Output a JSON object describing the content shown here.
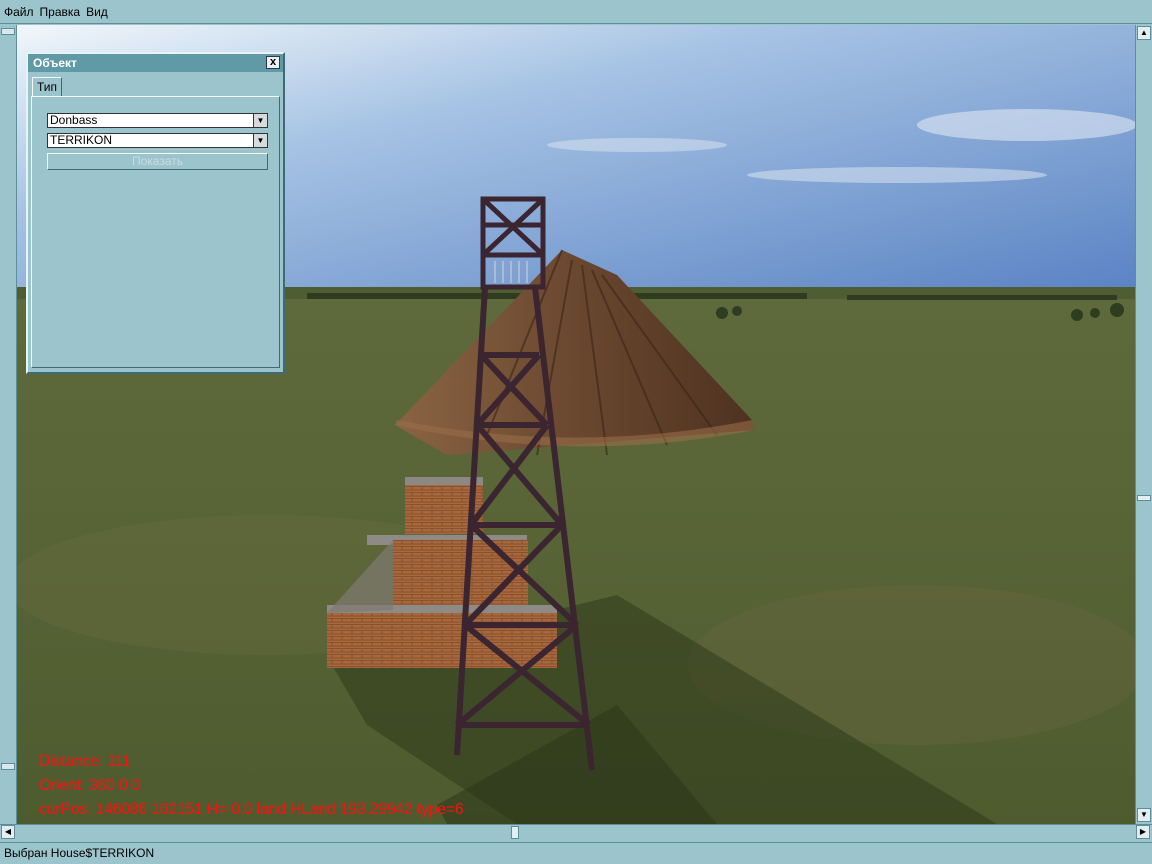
{
  "menu": {
    "items": [
      "Файл",
      "Правка",
      "Вид"
    ]
  },
  "panel": {
    "title": "Объект",
    "close_label": "x",
    "tab_label": "Тип",
    "combo1_value": "Donbass",
    "combo2_value": "TERRIKON",
    "show_button_label": "Показать"
  },
  "hud": {
    "distance": "Distance: 111",
    "orient": "Orient: 360 0 0",
    "curpos": "curPos: 146086 162151 H= 0.0 land HLand 193.29942 type=6"
  },
  "status": {
    "text": "Выбран House$TERRIKON"
  },
  "colors": {
    "hud_text": "#ff1010",
    "chrome": "#9cc4cc",
    "panel_title": "#5f9aa6"
  },
  "icons": {
    "close": "close-icon",
    "dropdown": "chevron-down-icon",
    "scroll_up": "arrow-up-icon",
    "scroll_down": "arrow-down-icon",
    "scroll_left": "arrow-left-icon",
    "scroll_right": "arrow-right-icon"
  }
}
